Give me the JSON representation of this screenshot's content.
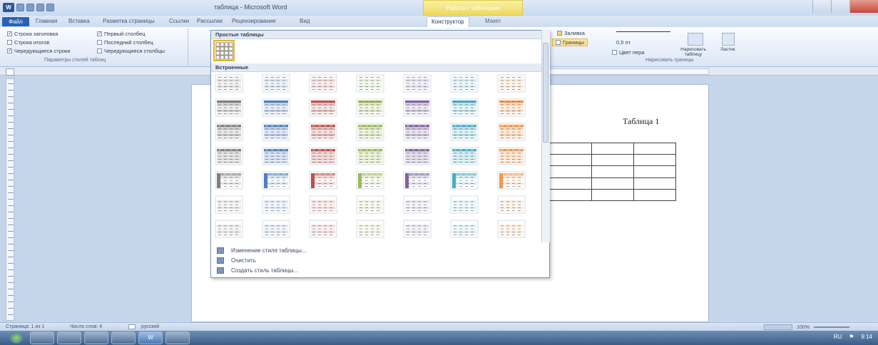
{
  "window": {
    "title": "таблица - Microsoft Word",
    "context_group": "Работа с таблицами"
  },
  "ribbon_tabs": [
    "Файл",
    "Главная",
    "Вставка",
    "Разметка страницы",
    "Ссылки",
    "Рассылки",
    "Рецензирование",
    "Вид",
    "Конструктор",
    "Макет"
  ],
  "active_tab": "Конструктор",
  "table_style_options": {
    "items": [
      {
        "label": "Строка заголовка",
        "checked": true
      },
      {
        "label": "Строка итогов",
        "checked": false
      },
      {
        "label": "Чередующиеся строки",
        "checked": true
      },
      {
        "label": "Первый столбец",
        "checked": true
      },
      {
        "label": "Последний столбец",
        "checked": false
      },
      {
        "label": "Чередующиеся столбцы",
        "checked": false
      }
    ],
    "group_label": "Параметры стилей таблиц"
  },
  "draw_borders": {
    "shading_label": "Заливка",
    "borders_label": "Границы",
    "pen_weight": "0,5 пт",
    "pen_color_label": "Цвет пера",
    "draw_table_label": "Нарисовать таблицу",
    "eraser_label": "Ластик",
    "group_label": "Нарисовать границы"
  },
  "gallery": {
    "plain_header": "Простые таблицы",
    "builtin_header": "Встроенные",
    "menu": [
      {
        "icon": "modify-table-style-icon",
        "label": "Изменение стиля таблицы..."
      },
      {
        "icon": "clear-icon",
        "label": "Очистить"
      },
      {
        "icon": "new-table-style-icon",
        "label": "Создать стиль таблицы..."
      }
    ],
    "palette": [
      "#7f7f7f",
      "#4f81bd",
      "#c0504d",
      "#9bbb59",
      "#8064a2",
      "#4bacc6",
      "#f79646"
    ]
  },
  "document": {
    "caption": "Таблица 1"
  },
  "status": {
    "page": "Страница: 1 из 1",
    "words": "Число слов: 4",
    "language": "русский",
    "zoom": "100%"
  },
  "taskbar": {
    "app_label": "W",
    "tray_lang": "RU",
    "time": "9:14"
  }
}
